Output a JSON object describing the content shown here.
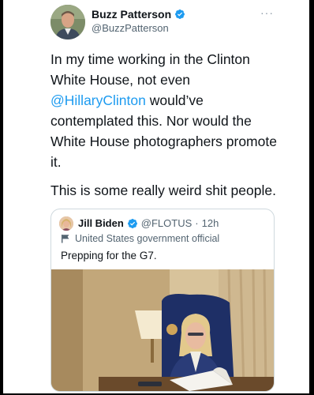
{
  "tweet": {
    "author_name": "Buzz Patterson",
    "author_handle": "@BuzzPatterson",
    "text_line1_pre": "In my time working in the Clinton White House, not even ",
    "mention": "@HillaryClinton",
    "text_line1_post": " would’ve contemplated this. Nor would the White House photographers promote it.",
    "text_line2": "This is some really weird shit people."
  },
  "quoted": {
    "author_name": "Jill Biden",
    "author_handle": "@FLOTUS",
    "separator": "·",
    "time": "12h",
    "label": "United States government official",
    "text": "Prepping for the G7."
  },
  "colors": {
    "link": "#1d9bf0",
    "verified": "#1d9bf0",
    "secondary_text": "#536471"
  },
  "icons": [
    "verified-badge-icon",
    "more-options-icon",
    "government-flag-icon"
  ]
}
